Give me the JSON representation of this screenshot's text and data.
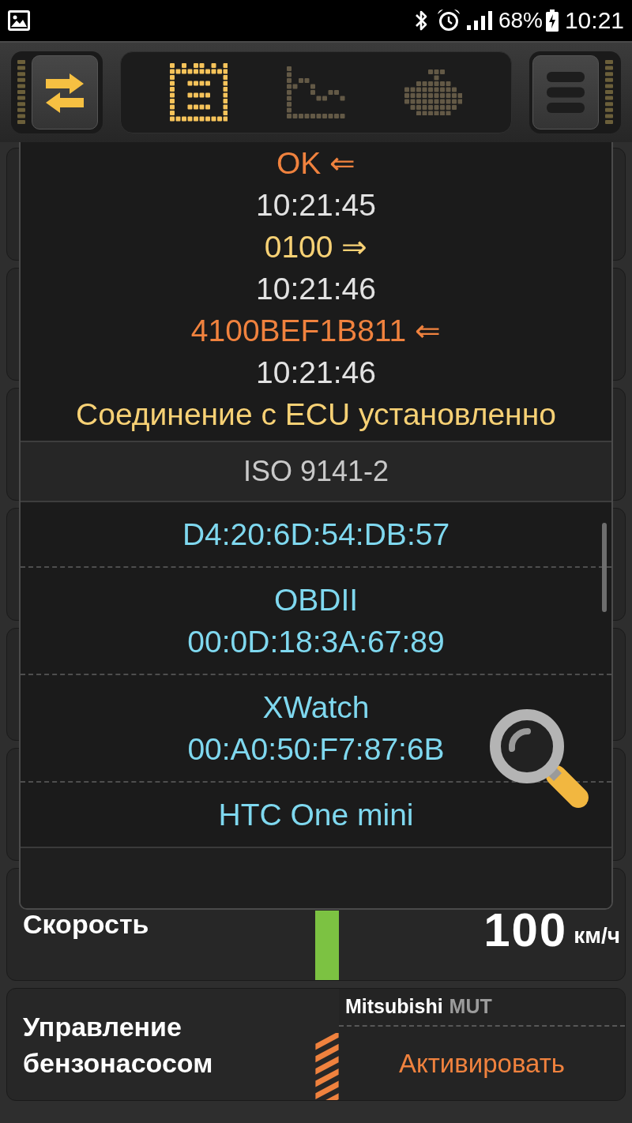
{
  "status_bar": {
    "battery": "68%",
    "time": "10:21"
  },
  "toolbar": {
    "tabs": [
      {
        "selected": true
      },
      {
        "selected": false
      },
      {
        "selected": false
      }
    ]
  },
  "dialog": {
    "log": [
      {
        "kind": "received",
        "text": "OK ⇐"
      },
      {
        "kind": "time",
        "text": "10:21:45"
      },
      {
        "kind": "sent",
        "text": "0100 ⇒"
      },
      {
        "kind": "time",
        "text": "10:21:46"
      },
      {
        "kind": "received",
        "text": "4100BEF1B811 ⇐"
      },
      {
        "kind": "time",
        "text": "10:21:46"
      },
      {
        "kind": "status",
        "text": "Соединение с ECU установленно"
      }
    ],
    "protocol": "ISO 9141-2",
    "devices": [
      {
        "address": "D4:20:6D:54:DB:57",
        "selected": false
      },
      {
        "name": "OBDII",
        "address": "00:0D:18:3A:67:89",
        "selected": false
      },
      {
        "name": "XWatch",
        "address": "00:A0:50:F7:87:6B",
        "selected": false
      },
      {
        "name": "HTC One mini",
        "selected": false
      }
    ]
  },
  "cards": [
    {
      "kind": "sensor",
      "label": "Скорость",
      "value": "100",
      "unit": "км/ч"
    },
    {
      "kind": "actuator",
      "label": "Управление бензонасосом",
      "make": "Mitsubishi",
      "protocol": "MUT",
      "action": "Активировать"
    }
  ]
}
